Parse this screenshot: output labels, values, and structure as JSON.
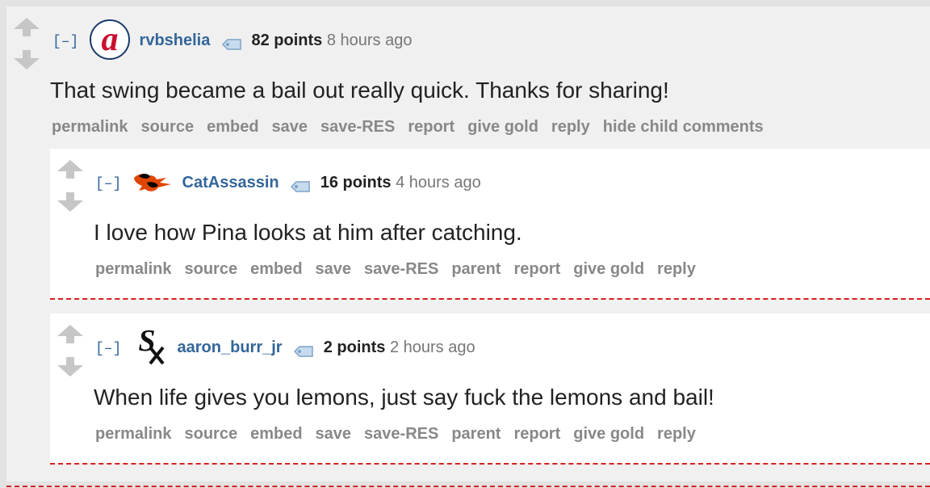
{
  "comments": [
    {
      "collapse": "[–]",
      "author": "rvbshelia",
      "flair_icon": "braves-a-icon",
      "score": "82 points",
      "time": "8 hours ago",
      "body": "That swing became a bail out really quick. Thanks for sharing!",
      "buttons": [
        "permalink",
        "source",
        "embed",
        "save",
        "save-RES",
        "report",
        "give gold",
        "reply",
        "hide child comments"
      ]
    },
    {
      "collapse": "[–]",
      "author": "CatAssassin",
      "flair_icon": "orioles-bird-icon",
      "score": "16 points",
      "time": "4 hours ago",
      "body": "I love how Pina looks at him after catching.",
      "buttons": [
        "permalink",
        "source",
        "embed",
        "save",
        "save-RES",
        "parent",
        "report",
        "give gold",
        "reply"
      ]
    },
    {
      "collapse": "[–]",
      "author": "aaron_burr_jr",
      "flair_icon": "white-sox-logo-icon",
      "score": "2 points",
      "time": "2 hours ago",
      "body": "When life gives you lemons, just say fuck the lemons and bail!",
      "buttons": [
        "permalink",
        "source",
        "embed",
        "save",
        "save-RES",
        "parent",
        "report",
        "give gold",
        "reply"
      ]
    }
  ],
  "colors": {
    "author": "#336699",
    "buttons": "#888888",
    "separator": "#d82020"
  }
}
